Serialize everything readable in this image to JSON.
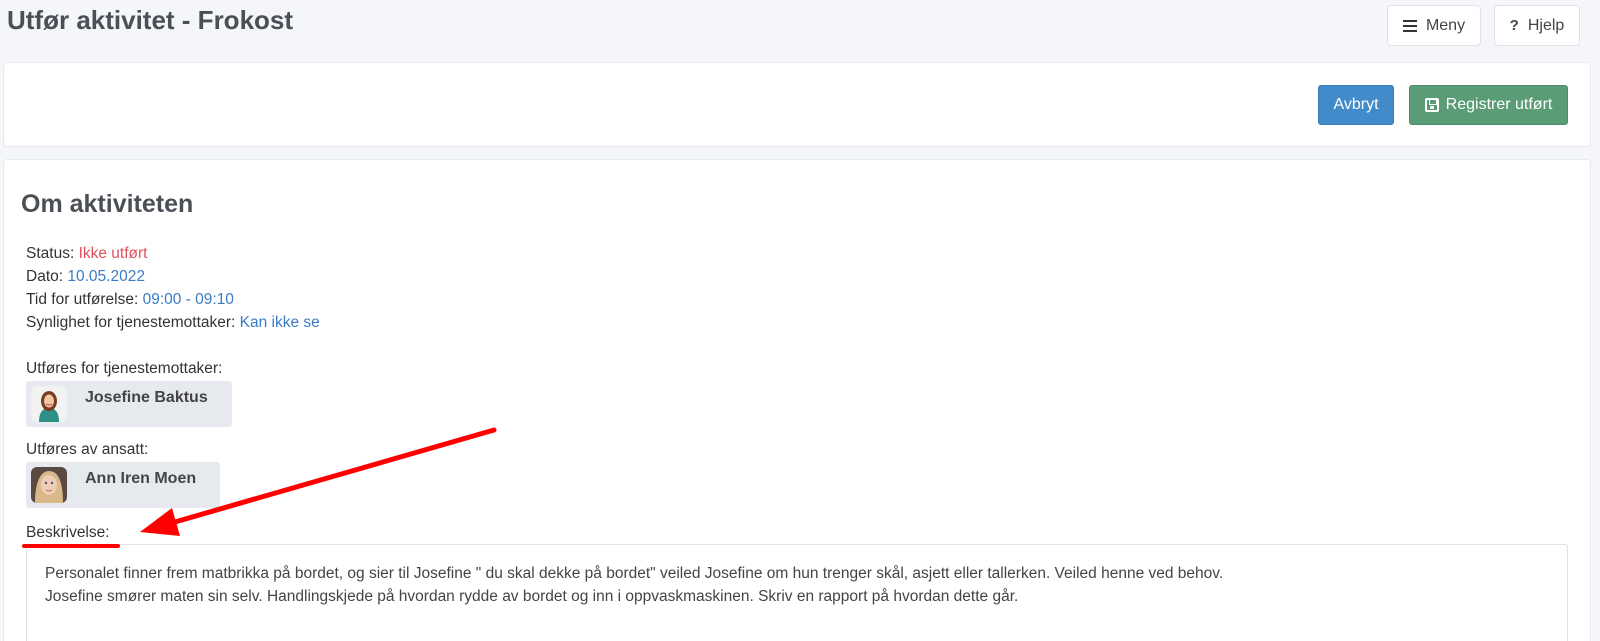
{
  "header": {
    "title": "Utfør aktivitet - Frokost",
    "menu_label": "Meny",
    "help_label": "Hjelp",
    "help_symbol": "?"
  },
  "actions": {
    "cancel_label": "Avbryt",
    "register_label": "Registrer utført"
  },
  "about": {
    "title": "Om aktiviteten",
    "status_label": "Status:",
    "status_value": "Ikke utført",
    "date_label": "Dato:",
    "date_value": "10.05.2022",
    "time_label": "Tid for utførelse:",
    "time_value": "09:00 - 09:10",
    "visibility_label": "Synlighet for tjenestemottaker:",
    "visibility_value": "Kan ikke se"
  },
  "recipient": {
    "label": "Utføres for tjenestemottaker:",
    "name": "Josefine Baktus"
  },
  "employee": {
    "label": "Utføres av ansatt:",
    "name": "Ann Iren Moen"
  },
  "description": {
    "label": "Beskrivelse:",
    "line1": "Personalet finner frem matbrikka på bordet, og sier til Josefine \" du skal dekke på bordet\" veiled Josefine om hun trenger skål, asjett eller tallerken. Veiled henne ved behov.",
    "line2": "Josefine smører maten sin selv. Handlingskjede på hvordan rydde av bordet og inn i oppvaskmaskinen.  Skriv en rapport på hvordan dette går."
  },
  "colors": {
    "status_red": "#e0525c",
    "link_blue": "#3a7cc4",
    "cancel_blue": "#428bca",
    "register_green": "#5a9c76",
    "annotation_red": "#ff0000"
  },
  "icons": {
    "menu": "hamburger-icon",
    "help": "question-icon",
    "register": "save-icon"
  }
}
